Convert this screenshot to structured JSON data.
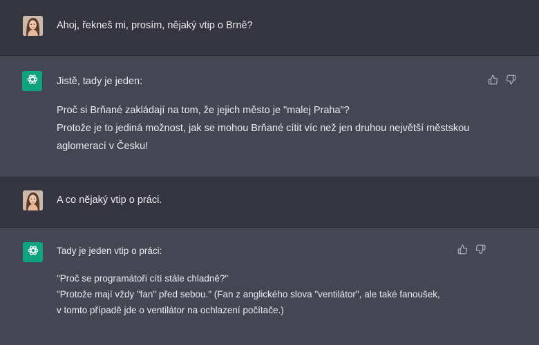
{
  "conversation": {
    "m1": {
      "role": "user",
      "text": "Ahoj, řekneš mi, prosím, nějaký vtip o Brně?"
    },
    "m2": {
      "role": "assistant",
      "intro": "Jistě, tady je jeden:",
      "lines": [
        "Proč si Brňané zakládají na tom, že jejich město je \"malej Praha\"?",
        "Protože je to jediná možnost, jak se mohou Brňané cítit víc než jen druhou největší městskou",
        "aglomerací v Česku!"
      ]
    },
    "m3": {
      "role": "user",
      "text": "A co nějaký vtip o práci."
    },
    "m4": {
      "role": "assistant",
      "intro": "Tady je jeden vtip o práci:",
      "lines": [
        "\"Proč se programátoři cítí stále chladně?\"",
        "\"Protože mají vždy \"fan\" před sebou.\" (Fan z anglického slova \"ventilátor\", ale také fanoušek,",
        "v tomto případě jde o ventilátor na ochlazení počítače.)"
      ]
    }
  },
  "icons": {
    "assistant_avatar": "openai-logo-icon",
    "user_avatar": "user-photo-avatar",
    "like": "thumbs-up-icon",
    "dislike": "thumbs-down-icon"
  },
  "colors": {
    "user_bg": "#343541",
    "assistant_bg": "#444654",
    "accent": "#10a37f",
    "text": "#ececf1",
    "icon": "#acacbe"
  }
}
